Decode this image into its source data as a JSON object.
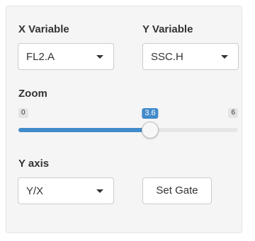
{
  "x_variable": {
    "label": "X Variable",
    "selected": "FL2.A"
  },
  "y_variable": {
    "label": "Y Variable",
    "selected": "SSC.H"
  },
  "zoom": {
    "label": "Zoom",
    "min": "0",
    "max": "6",
    "value": "3.6",
    "fraction": 0.6
  },
  "y_axis": {
    "label": "Y axis",
    "selected": "Y/X"
  },
  "set_gate_button": {
    "label": "Set Gate"
  },
  "colors": {
    "accent": "#428bca",
    "panel_bg": "#f5f5f5",
    "text": "#333333"
  }
}
